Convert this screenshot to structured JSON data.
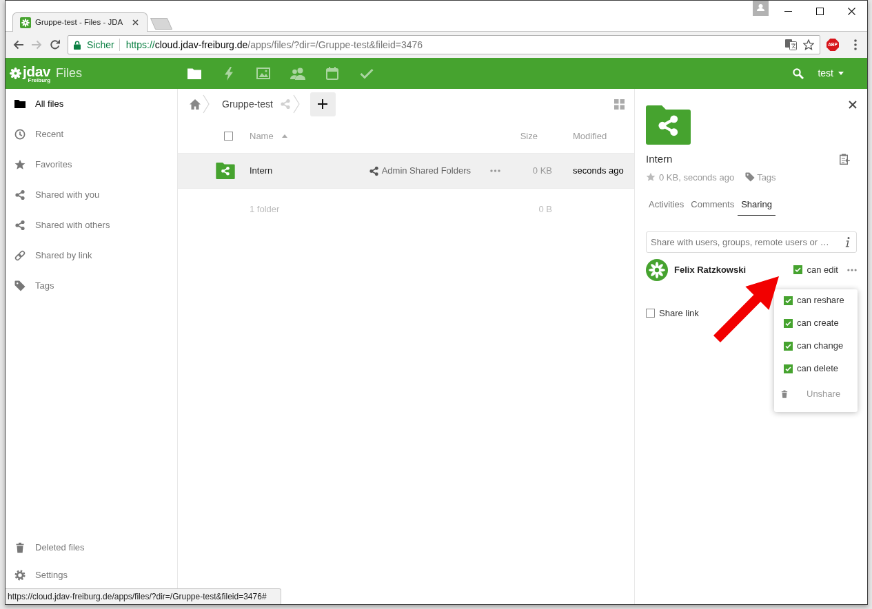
{
  "browser": {
    "tabs": [
      {
        "title": "Gruppe-test - Files - JDA",
        "selected": true
      }
    ],
    "address_bar": {
      "security_label": "Sicher",
      "url_scheme": "https://",
      "url_host": "cloud.jdav-freiburg.de",
      "url_path": "/apps/files/?dir=/Gruppe-test&fileid=3476"
    },
    "extension_badge": "ABP"
  },
  "app_header": {
    "logo_text": "jdav",
    "logo_subtext": "Freiburg",
    "app_name": "Files",
    "app_icons": [
      {
        "selected": true
      },
      {
        "selected": false
      },
      {
        "selected": false
      },
      {
        "selected": false
      },
      {
        "selected": false
      },
      {
        "selected": false
      }
    ],
    "user": "test"
  },
  "sidebar": {
    "items": [
      {
        "label": "All files",
        "selected": true
      },
      {
        "label": "Recent",
        "selected": false
      },
      {
        "label": "Favorites",
        "selected": false
      },
      {
        "label": "Shared with you",
        "selected": false
      },
      {
        "label": "Shared with others",
        "selected": false
      },
      {
        "label": "Shared by link",
        "selected": false
      },
      {
        "label": "Tags",
        "selected": false
      }
    ],
    "footer_items": [
      {
        "label": "Deleted files"
      },
      {
        "label": "Settings"
      }
    ]
  },
  "file_list": {
    "breadcrumb": [
      {
        "label": "Gruppe-test"
      }
    ],
    "select_all_checked": false,
    "columns": {
      "name": "Name",
      "size": "Size",
      "modified": "Modified"
    },
    "rows": [
      {
        "name": "Intern",
        "shared_by": "Admin Shared Folders",
        "size": "0 KB",
        "modified": "seconds ago",
        "selected": true
      }
    ],
    "summary": {
      "count": "1 folder",
      "size": "0 B"
    }
  },
  "details": {
    "name": "Intern",
    "favorite": false,
    "meta": "0 KB, seconds ago",
    "tags_label": "Tags",
    "tabs": [
      {
        "label": "Activities",
        "selected": false
      },
      {
        "label": "Comments",
        "selected": false
      },
      {
        "label": "Sharing",
        "selected": true
      }
    ],
    "share_input": {
      "placeholder": "Share with users, groups, remote users or …"
    },
    "shares": [
      {
        "name": "Felix Ratzkowski",
        "can_edit": {
          "label": "can edit",
          "checked": true
        },
        "menu": {
          "permissions": [
            {
              "label": "can reshare",
              "checked": true
            },
            {
              "label": "can create",
              "checked": true
            },
            {
              "label": "can change",
              "checked": true
            },
            {
              "label": "can delete",
              "checked": true
            }
          ],
          "unshare": "Unshare"
        }
      }
    ],
    "share_link": {
      "label": "Share link",
      "checked": false
    }
  },
  "status_bubble": "https://cloud.jdav-freiburg.de/apps/files/?dir=/Gruppe-test&fileid=3476#"
}
